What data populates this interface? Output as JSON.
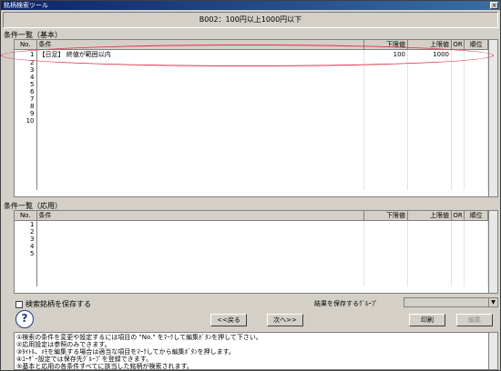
{
  "window": {
    "title": "銘柄検索ツール",
    "close_glyph": "×",
    "subtitle": "B002：100円以上1000円以下"
  },
  "basic_section": {
    "label": "条件一覧（基本）",
    "columns": {
      "no": "No.",
      "condition": "条件",
      "lower": "下限値",
      "upper": "上限値",
      "or": "OR",
      "order": "順位"
    },
    "rows": [
      {
        "no": "1",
        "condition": "【日足】 終値が範囲以内",
        "lower": "100",
        "upper": "1000"
      },
      {
        "no": "2"
      },
      {
        "no": "3"
      },
      {
        "no": "4"
      },
      {
        "no": "5"
      },
      {
        "no": "6"
      },
      {
        "no": "7"
      },
      {
        "no": "8"
      },
      {
        "no": "9"
      },
      {
        "no": "10"
      }
    ]
  },
  "applied_section": {
    "label": "条件一覧（応用）",
    "columns": {
      "no": "No.",
      "condition": "条件",
      "lower": "下限値",
      "upper": "上限値",
      "or": "OR",
      "order": "順位"
    },
    "rows": [
      {
        "no": "1"
      },
      {
        "no": "2"
      },
      {
        "no": "3"
      },
      {
        "no": "4"
      },
      {
        "no": "5"
      }
    ]
  },
  "save_checkbox_label": "検索銘柄を保存する",
  "group_label": "結果を保存するｸﾞﾙｰﾌﾟ",
  "buttons": {
    "help": "?",
    "back": "<<戻る",
    "next": "次へ>>",
    "print": "印刷",
    "edit": "編集"
  },
  "notes": [
    "①検索の条件を変更や設定するには項目の \"No.\" をﾏｰｸして編集ﾎﾞﾀﾝを押して下さい。",
    "②応用設定は参照のみできます。",
    "③ﾀｲﾄﾙ、ﾒﾓを編集する場合は適当な項目をﾏｰｸしてから編集ﾎﾞﾀﾝを押します。",
    "④ﾕｰｻﾞｰ設定では保存先ｸﾞﾙｰﾌﾟを登録できます。",
    "⑤基本と応用の各条件すべてに該当した銘柄が検索されます。"
  ]
}
